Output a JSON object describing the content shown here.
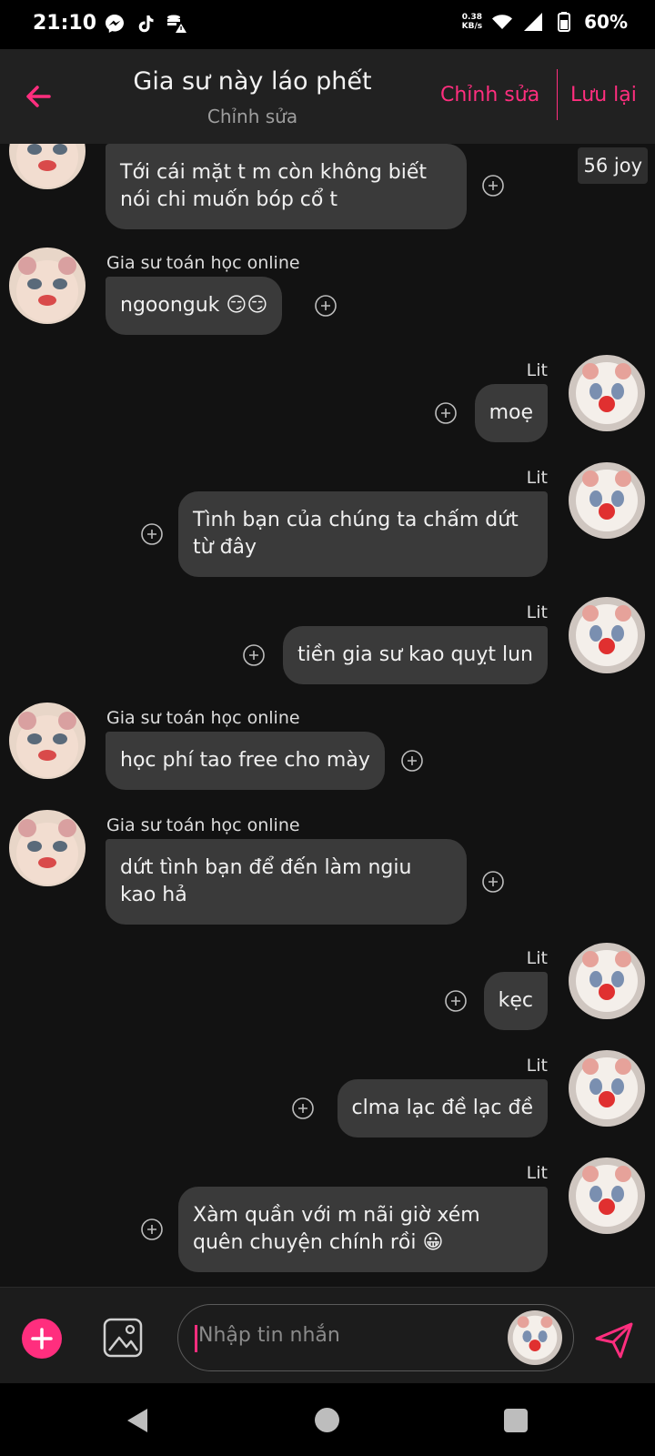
{
  "status_bar": {
    "time": "21:10",
    "net_speed_value": "0.38",
    "net_speed_unit": "KB/s",
    "battery": "60%"
  },
  "header": {
    "title": "Gia sư này láo phết",
    "subtitle": "Chỉnh sửa",
    "edit_label": "Chỉnh sửa",
    "save_label": "Lưu lại",
    "accent_color": "#ff2e7e"
  },
  "badge": {
    "joy": "56 joy"
  },
  "messages": [
    {
      "side": "in",
      "sender": "",
      "text_lines": [
        "Tới cái mặt t m còn không biết",
        "nói chi muốn bóp cổ t"
      ]
    },
    {
      "side": "in",
      "sender": "Gia sư toán học online",
      "text_lines": [
        "ngoonguk 😏😏"
      ]
    },
    {
      "side": "out",
      "sender": "Lit",
      "text_lines": [
        "moẹ"
      ]
    },
    {
      "side": "out",
      "sender": "Lit",
      "text_lines": [
        "Tình bạn của chúng ta chấm dứt",
        "từ đây"
      ]
    },
    {
      "side": "out",
      "sender": "Lit",
      "text_lines": [
        "tiền gia sư kao quỵt lun"
      ]
    },
    {
      "side": "in",
      "sender": "Gia sư toán học online",
      "text_lines": [
        "học phí tao free cho mày"
      ]
    },
    {
      "side": "in",
      "sender": "Gia sư toán học online",
      "text_lines": [
        "dứt tình bạn để đến làm ngiu",
        "kao hả"
      ]
    },
    {
      "side": "out",
      "sender": "Lit",
      "text_lines": [
        "kẹc"
      ]
    },
    {
      "side": "out",
      "sender": "Lit",
      "text_lines": [
        "clma lạc đề lạc đề"
      ]
    },
    {
      "side": "out",
      "sender": "Lit",
      "text_lines": [
        "Xàm quần với m nãi giờ xém",
        "quên chuyện chính rồi 😀"
      ]
    }
  ],
  "input": {
    "placeholder": "Nhập tin nhắn"
  },
  "icons": {
    "back": "arrow-left-icon",
    "add": "plus-circle-icon",
    "gallery": "image-icon",
    "send": "send-icon",
    "reaction": "add-reaction-icon"
  }
}
